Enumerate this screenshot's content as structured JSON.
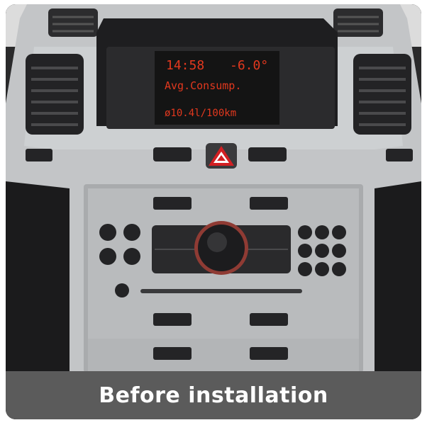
{
  "caption": "Before installation",
  "display": {
    "time": "14:58",
    "temperature": "-6.0°",
    "line2": "Avg.Consump.",
    "line3": "ø10.4l/100km"
  },
  "colors": {
    "caption_bar": "#5b5b5b",
    "lcd_red": "#e2381e",
    "hazard_red": "#d21f22",
    "panel_silver": "#b7b9bb"
  }
}
